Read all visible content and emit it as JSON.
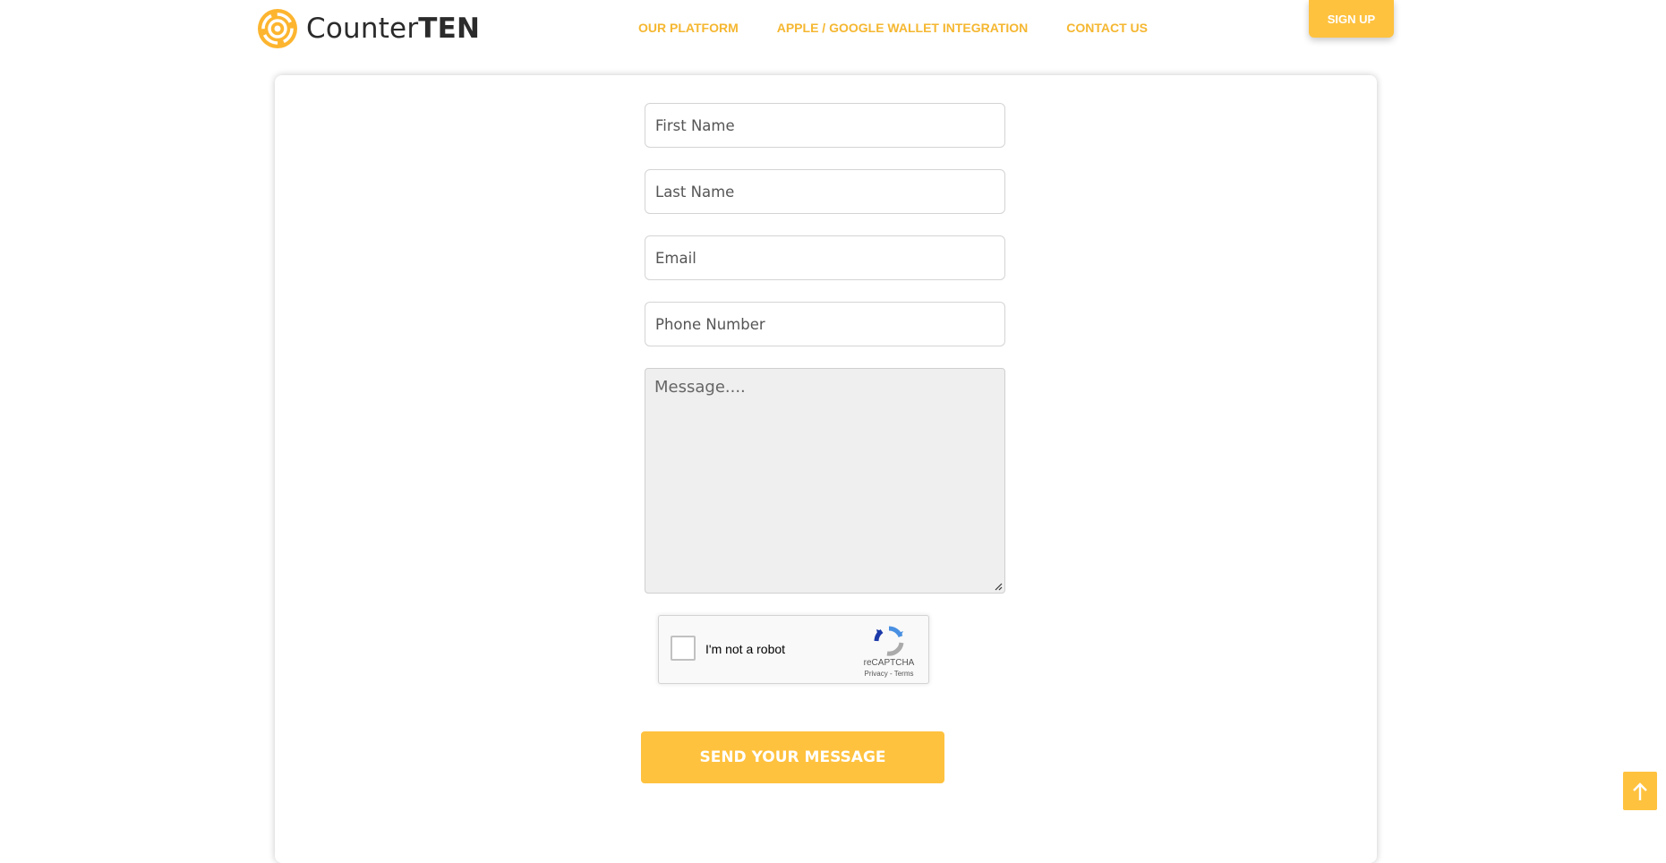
{
  "header": {
    "logo": {
      "text_regular": "Counter",
      "text_bold": "TEN",
      "icon": "counterten-logo-icon"
    },
    "nav": [
      {
        "label": "OUR PLATFORM"
      },
      {
        "label": "APPLE / GOOGLE WALLET INTEGRATION"
      },
      {
        "label": "CONTACT US"
      }
    ],
    "signup_label": "SIGN UP"
  },
  "form": {
    "first_name_placeholder": "First Name",
    "last_name_placeholder": "Last Name",
    "email_placeholder": "Email",
    "phone_placeholder": "Phone Number",
    "message_placeholder": "Message....",
    "captcha": {
      "label": "I'm not a robot",
      "brand": "reCAPTCHA",
      "links": "Privacy - Terms",
      "icon": "recaptcha-icon"
    },
    "submit_label": "SEND YOUR MESSAGE"
  },
  "scroll_top": {
    "icon": "arrow-up-icon"
  },
  "colors": {
    "accent": "#ffc23f",
    "nav_text": "#f5b731",
    "logo_text": "#2b2b2b"
  }
}
